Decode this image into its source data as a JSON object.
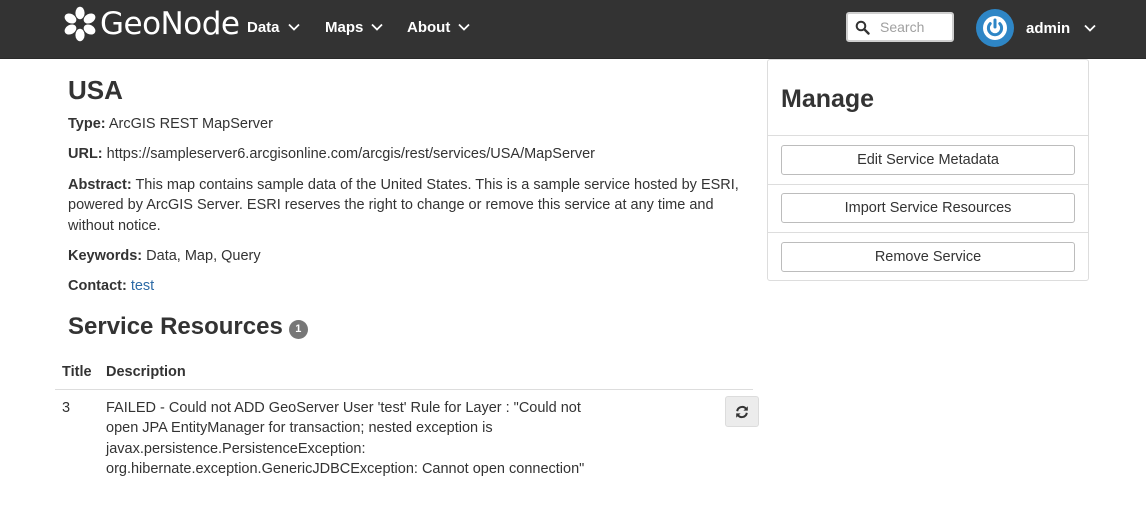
{
  "navbar": {
    "brand": "GeoNode",
    "menu": [
      {
        "label": "Data"
      },
      {
        "label": "Maps"
      },
      {
        "label": "About"
      }
    ],
    "search_placeholder": "Search",
    "user": "admin"
  },
  "service": {
    "title": "USA",
    "type_label": "Type:",
    "type_value": "ArcGIS REST MapServer",
    "url_label": "URL:",
    "url_value": "https://sampleserver6.arcgisonline.com/arcgis/rest/services/USA/MapServer",
    "abstract_label": "Abstract:",
    "abstract_value": "This map contains sample data of the United States. This is a sample service hosted by ESRI, powered by ArcGIS Server. ESRI reserves the right to change or remove this service at any time and without notice.",
    "keywords_label": "Keywords:",
    "keywords_value": "Data, Map, Query",
    "contact_label": "Contact:",
    "contact_value": "test"
  },
  "resources": {
    "title": "Service Resources",
    "count": "1",
    "columns": [
      "Title",
      "Description"
    ],
    "rows": [
      {
        "title": "3",
        "description": "FAILED - Could not ADD GeoServer User 'test' Rule for Layer : \"Could not open JPA EntityManager for transaction; nested exception is javax.persistence.PersistenceException: org.hibernate.exception.GenericJDBCException: Cannot open connection\""
      }
    ]
  },
  "manage": {
    "title": "Manage",
    "buttons": [
      {
        "label": "Edit Service Metadata"
      },
      {
        "label": "Import Service Resources"
      },
      {
        "label": "Remove Service"
      }
    ]
  },
  "colors": {
    "navbar_bg": "#333333",
    "link": "#2c6aa6",
    "avatar": "#2e86c6",
    "badge": "#777777"
  }
}
